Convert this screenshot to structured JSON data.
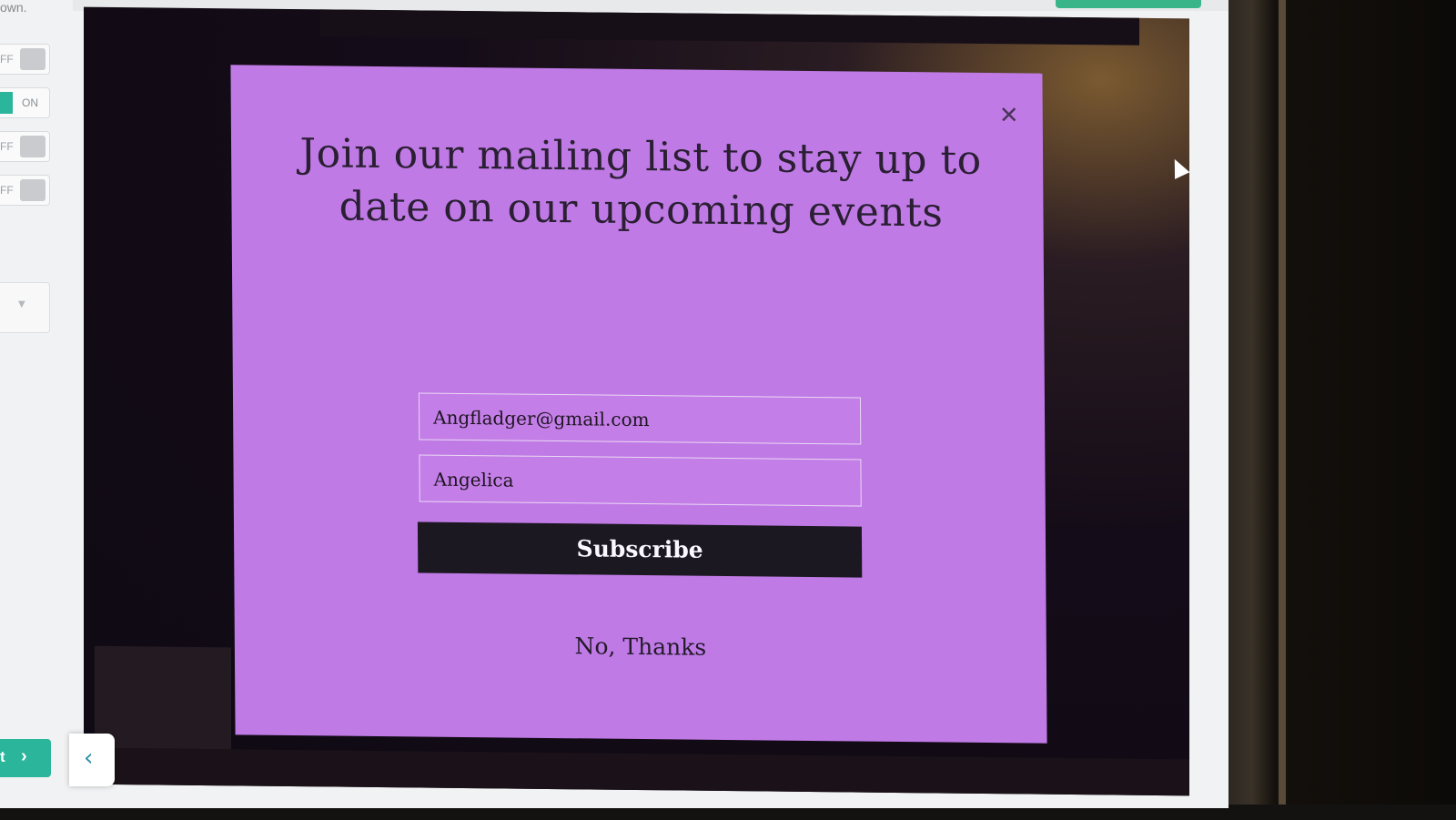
{
  "editor": {
    "top_text": "own.",
    "toggles": [
      {
        "label": "FF",
        "state": "off"
      },
      {
        "label": "ON",
        "state": "on"
      },
      {
        "label": "FF",
        "state": "off"
      },
      {
        "label": "FF",
        "state": "off"
      }
    ],
    "next_button": {
      "label": "t",
      "icon": "chevron-right-icon"
    },
    "collapse_button": {
      "icon": "chevron-left-icon",
      "glyph": "‹"
    }
  },
  "popup": {
    "background": "#c07ae6",
    "close_glyph": "✕",
    "headline": "Join our mailing list to stay up to date on our upcoming events",
    "email_value": "Angfladger@gmail.com",
    "name_value": "Angelica",
    "subscribe_label": "Subscribe",
    "dismiss_label": "No, Thanks"
  },
  "colors": {
    "accent": "#2bb59a",
    "button_dark": "#1c1822"
  }
}
